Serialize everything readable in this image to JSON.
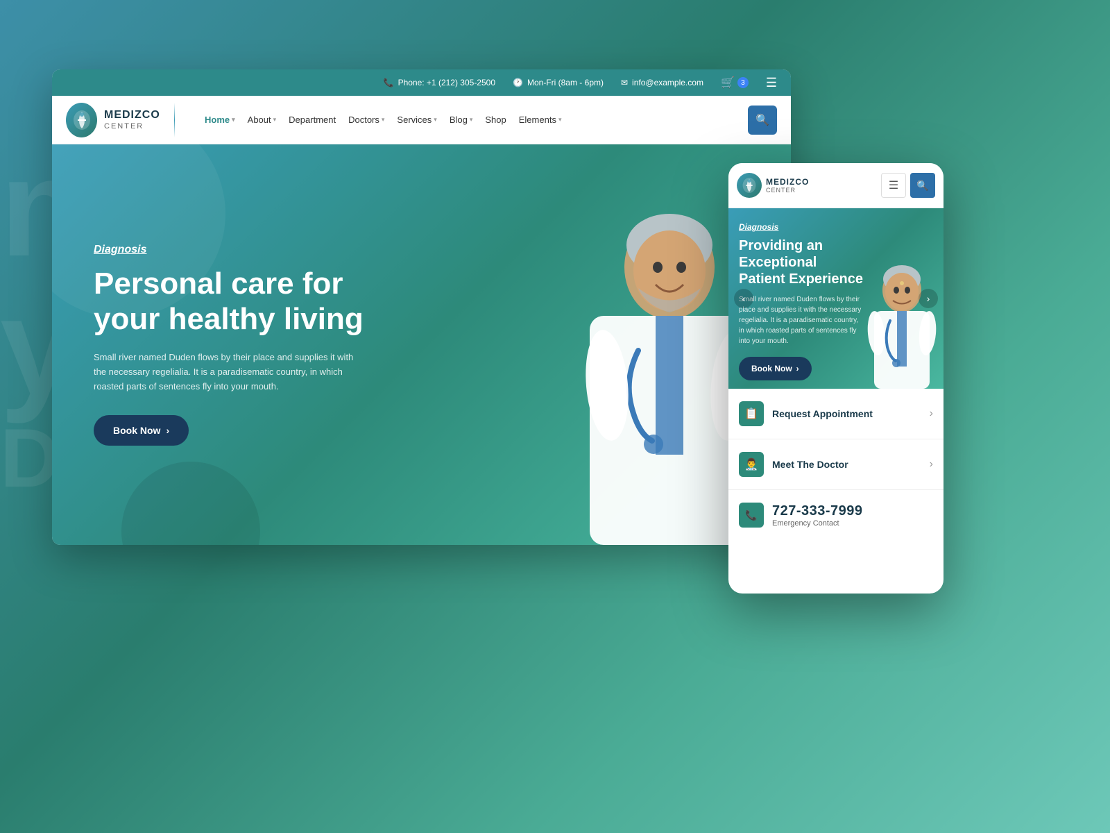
{
  "background": {
    "text_lines": [
      "na",
      "y",
      "Duden"
    ]
  },
  "desktop": {
    "topbar": {
      "phone_icon": "📞",
      "phone": "+1 (212) 305-2500",
      "phone_label": "Phone: +1 (212) 305-2500",
      "clock_icon": "🕐",
      "hours": "Mon-Fri (8am - 6pm)",
      "email_icon": "✉",
      "email": "info@example.com",
      "cart_count": "3"
    },
    "nav": {
      "logo_brand": "MEDIZCO",
      "logo_sub": "CENTER",
      "links": [
        {
          "label": "Home",
          "has_arrow": true,
          "active": true
        },
        {
          "label": "About",
          "has_arrow": true,
          "active": false
        },
        {
          "label": "Department",
          "has_arrow": false,
          "active": false
        },
        {
          "label": "Doctors",
          "has_arrow": true,
          "active": false
        },
        {
          "label": "Services",
          "has_arrow": true,
          "active": false
        },
        {
          "label": "Blog",
          "has_arrow": true,
          "active": false
        },
        {
          "label": "Shop",
          "has_arrow": false,
          "active": false
        },
        {
          "label": "Elements",
          "has_arrow": true,
          "active": false
        }
      ]
    },
    "hero": {
      "label": "Diagnosis",
      "title": "Personal care for your healthy living",
      "description": "Small river named Duden flows by their place and supplies it with the necessary regelialia. It is a paradisematic country, in which roasted parts of sentences fly into your mouth.",
      "book_btn": "Book Now"
    }
  },
  "mobile": {
    "logo_brand": "MEDIZCO",
    "logo_sub": "CENTER",
    "hero": {
      "label": "Diagnosis",
      "title": "Providing an Exceptional Patient Experience",
      "description": "Small river named Duden flows by their place and supplies it with the necessary regelialia. It is a paradisematic country, in which roasted parts of sentences fly into your mouth.",
      "book_btn": "Book Now"
    },
    "menu_items": [
      {
        "icon": "📋",
        "label": "Request Appointment"
      },
      {
        "icon": "👨‍⚕️",
        "label": "Meet The Doctor"
      }
    ],
    "emergency": {
      "phone": "727-333-7999",
      "label": "Emergency Contact"
    }
  }
}
